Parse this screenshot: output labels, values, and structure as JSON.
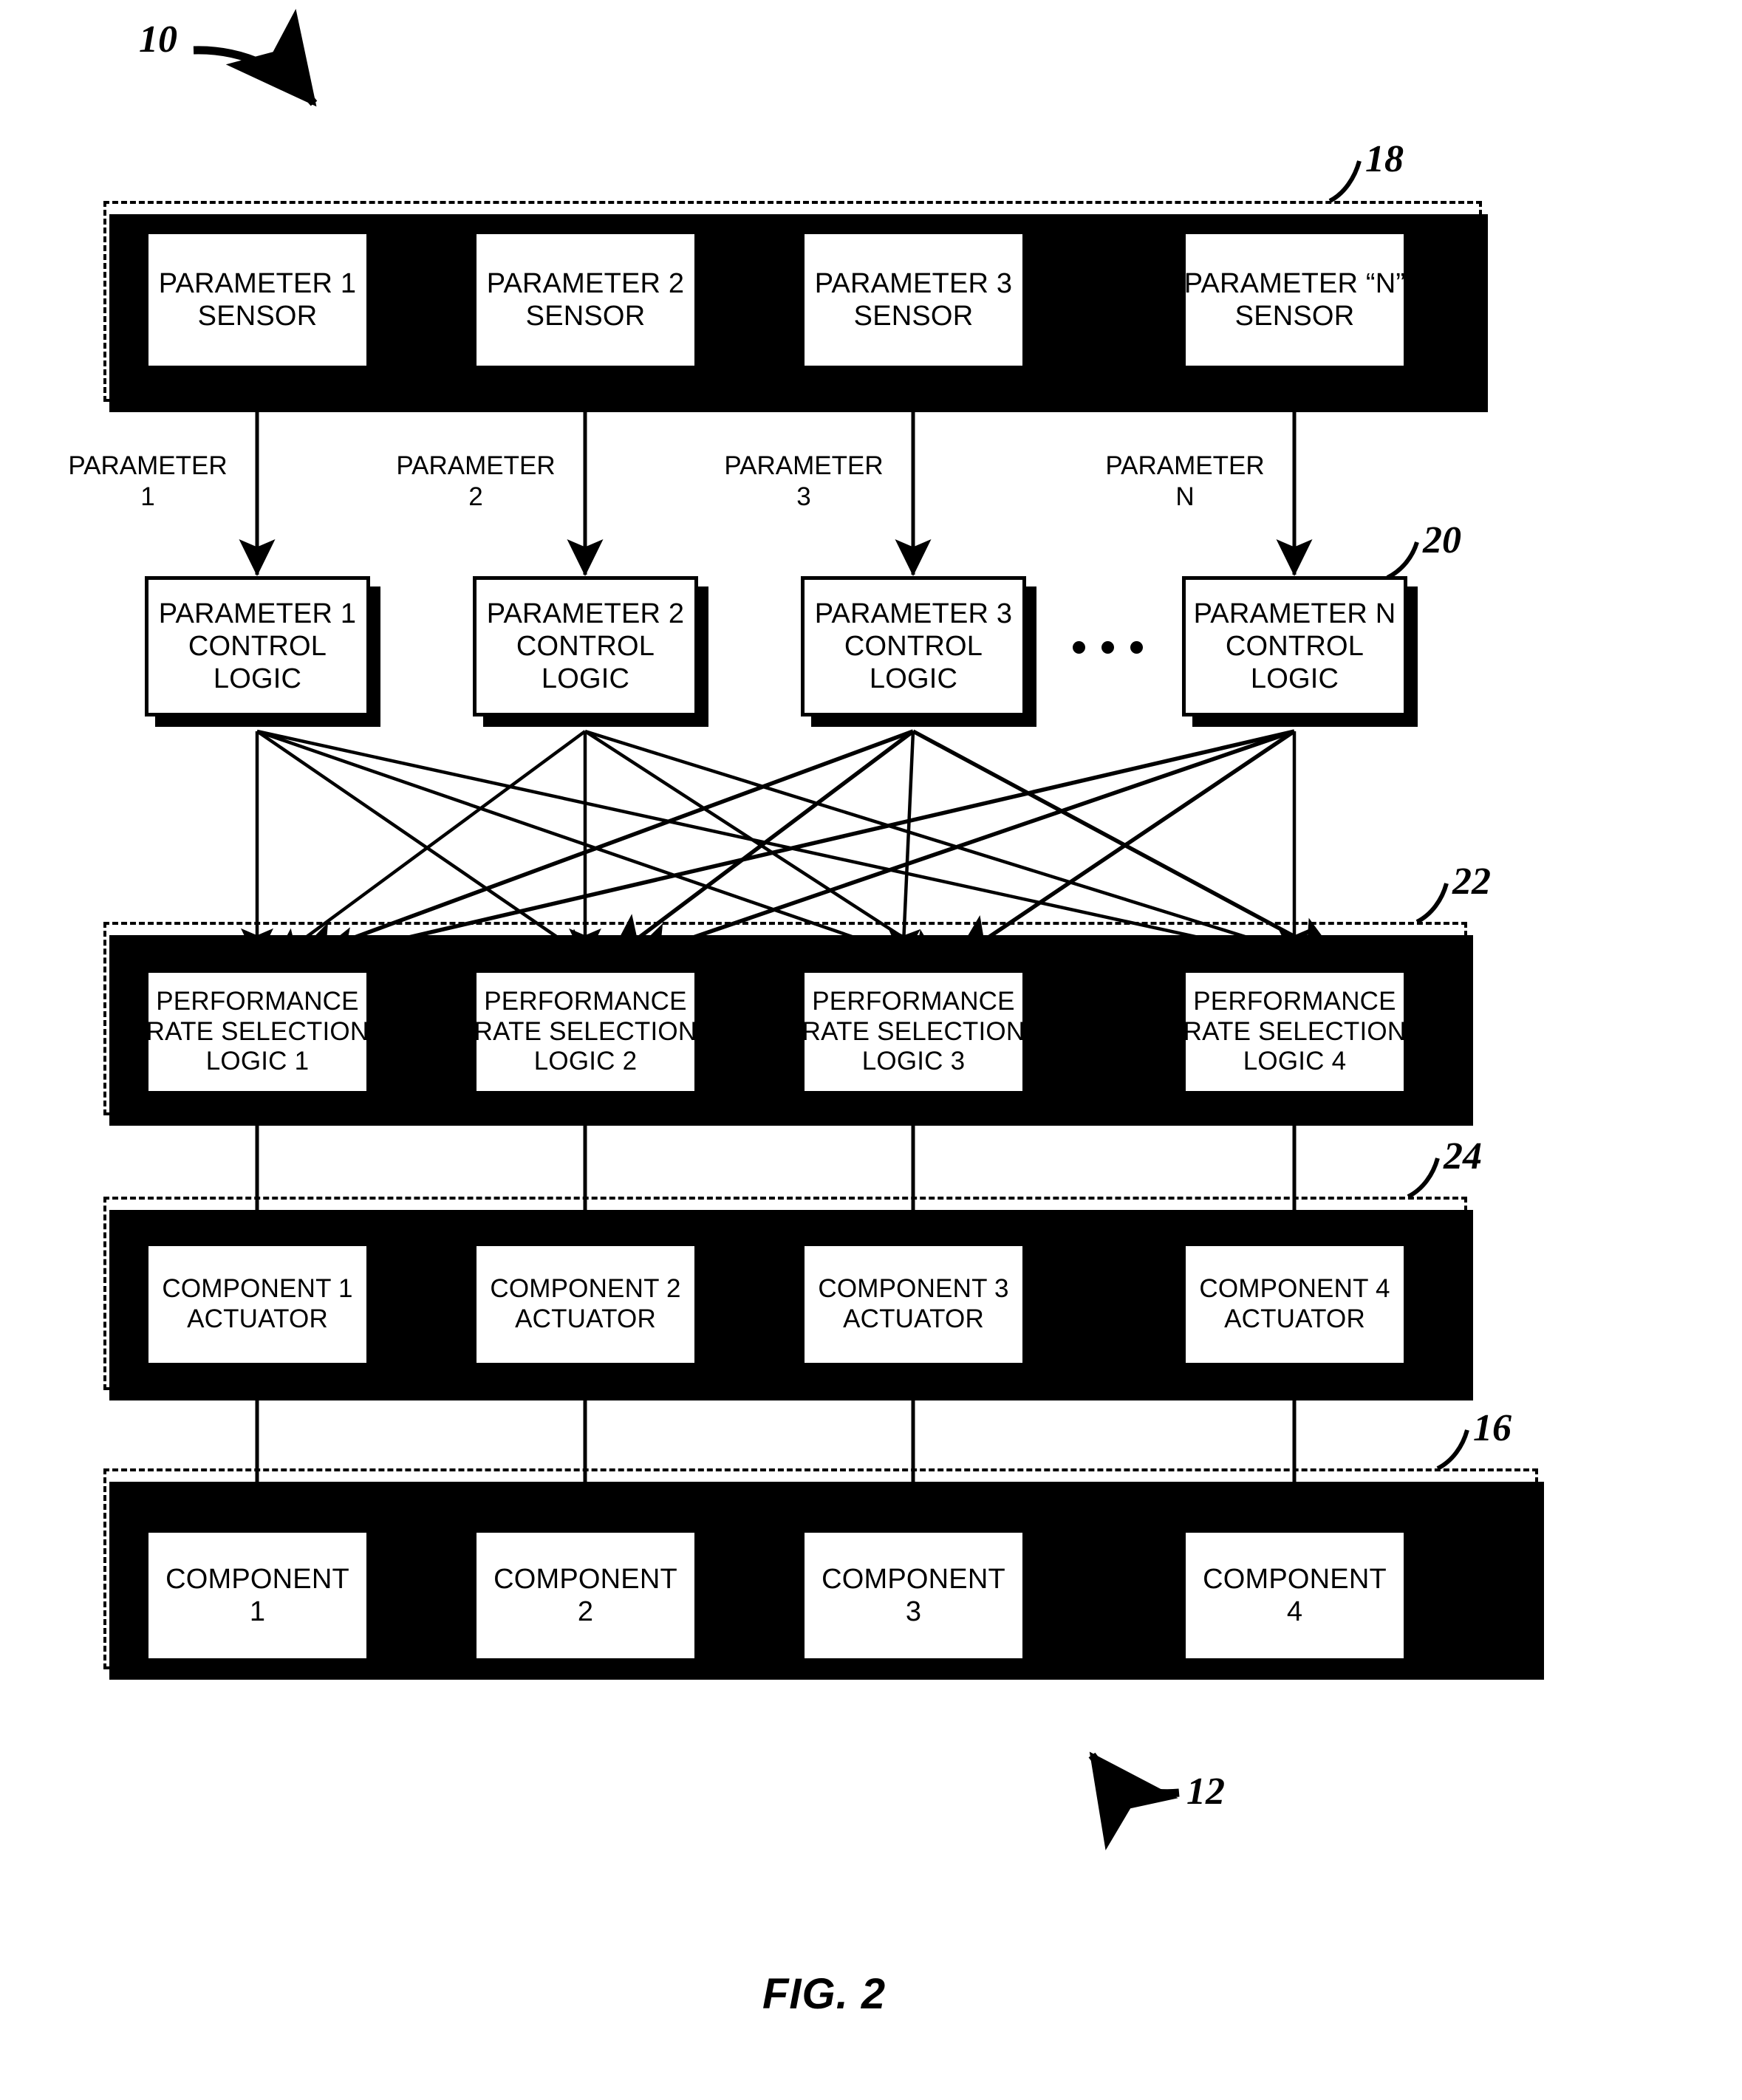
{
  "figure": {
    "caption": "FIG. 2",
    "reference_numerals": [
      {
        "id": "10",
        "text": "10"
      },
      {
        "id": "18",
        "text": "18"
      },
      {
        "id": "20",
        "text": "20"
      },
      {
        "id": "22",
        "text": "22"
      },
      {
        "id": "24",
        "text": "24"
      },
      {
        "id": "16",
        "text": "16"
      },
      {
        "id": "12",
        "text": "12"
      }
    ]
  },
  "sensor_row": {
    "group_ref": "18",
    "ellipsis": "• • •",
    "nodes": [
      {
        "line1": "PARAMETER 1",
        "line2": "SENSOR"
      },
      {
        "line1": "PARAMETER 2",
        "line2": "SENSOR"
      },
      {
        "line1": "PARAMETER 3",
        "line2": "SENSOR"
      },
      {
        "line1": "PARAMETER “N”",
        "line2": "SENSOR"
      }
    ]
  },
  "signal_labels": [
    {
      "line1": "PARAMETER",
      "line2": "1"
    },
    {
      "line1": "PARAMETER",
      "line2": "2"
    },
    {
      "line1": "PARAMETER",
      "line2": "3"
    },
    {
      "line1": "PARAMETER",
      "line2": "N"
    }
  ],
  "control_logic_row": {
    "group_ref": "20",
    "ellipsis": "• • •",
    "nodes": [
      {
        "line1": "PARAMETER 1",
        "line2": "CONTROL",
        "line3": "LOGIC"
      },
      {
        "line1": "PARAMETER 2",
        "line2": "CONTROL",
        "line3": "LOGIC"
      },
      {
        "line1": "PARAMETER 3",
        "line2": "CONTROL",
        "line3": "LOGIC"
      },
      {
        "line1": "PARAMETER N",
        "line2": "CONTROL",
        "line3": "LOGIC"
      }
    ]
  },
  "rate_selection_row": {
    "group_ref": "22",
    "ellipsis": "• • •",
    "nodes": [
      {
        "line1": "PERFORMANCE",
        "line2": "RATE SELECTION",
        "line3": "LOGIC 1"
      },
      {
        "line1": "PERFORMANCE",
        "line2": "RATE SELECTION",
        "line3": "LOGIC 2"
      },
      {
        "line1": "PERFORMANCE",
        "line2": "RATE SELECTION",
        "line3": "LOGIC 3"
      },
      {
        "line1": "PERFORMANCE",
        "line2": "RATE SELECTION",
        "line3": "LOGIC 4"
      }
    ]
  },
  "actuator_row": {
    "group_ref": "24",
    "nodes": [
      {
        "line1": "COMPONENT 1",
        "line2": "ACTUATOR"
      },
      {
        "line1": "COMPONENT 2",
        "line2": "ACTUATOR"
      },
      {
        "line1": "COMPONENT 3",
        "line2": "ACTUATOR"
      },
      {
        "line1": "COMPONENT 4",
        "line2": "ACTUATOR"
      }
    ]
  },
  "component_row": {
    "group_ref": "16",
    "ellipsis": "• • •",
    "nodes": [
      {
        "line1": "COMPONENT",
        "line2": "1"
      },
      {
        "line1": "COMPONENT",
        "line2": "2"
      },
      {
        "line1": "COMPONENT",
        "line2": "3"
      },
      {
        "line1": "COMPONENT",
        "line2": "4"
      }
    ]
  },
  "colors": {
    "ink": "#000000",
    "paper": "#ffffff"
  }
}
